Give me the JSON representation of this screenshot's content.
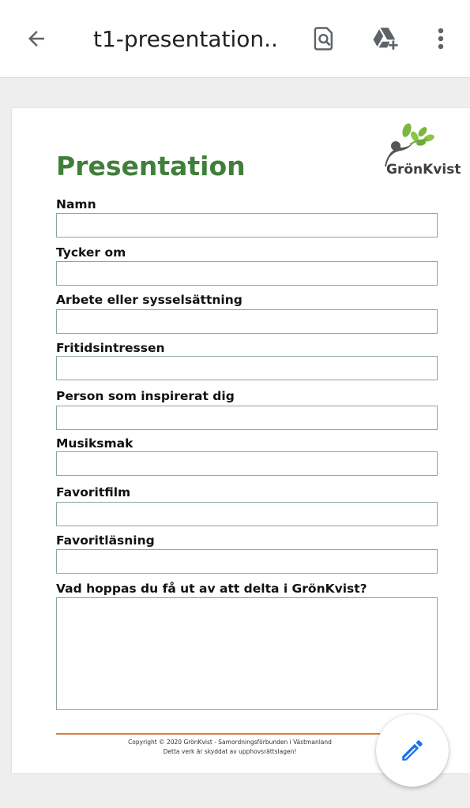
{
  "appbar": {
    "title": "t1-presentation....",
    "icons": [
      "arrow-back-icon",
      "find-in-page-icon",
      "add-to-drive-icon",
      "more-vert-icon"
    ]
  },
  "document": {
    "title": "Presentation",
    "logo_text": "GrönKvist",
    "fields": [
      {
        "label": "Namn",
        "value": ""
      },
      {
        "label": "Tycker om",
        "value": ""
      },
      {
        "label": "Arbete eller sysselsättning",
        "value": ""
      },
      {
        "label": "Fritidsintressen",
        "value": ""
      },
      {
        "label": "Person som inspirerat dig",
        "value": ""
      },
      {
        "label": "Musiksmak",
        "value": ""
      },
      {
        "label": "Favoritfilm",
        "value": ""
      },
      {
        "label": "Favoritläsning",
        "value": ""
      },
      {
        "label": "Vad hoppas du få ut av att delta i GrönKvist?",
        "value": ""
      }
    ],
    "footer": {
      "line1": "Copyright © 2020 GrönKvist - Samordningsförbunden i Västmanland",
      "line2": "Detta verk är skyddat av upphovsrättslagen!"
    }
  },
  "colors": {
    "title_green": "#3f7f3a",
    "box_border": "#8aa6a3",
    "footer_line": "#e07a3b",
    "fab_icon": "#1a73e8"
  },
  "fab": {
    "icon": "edit-pencil-icon"
  }
}
